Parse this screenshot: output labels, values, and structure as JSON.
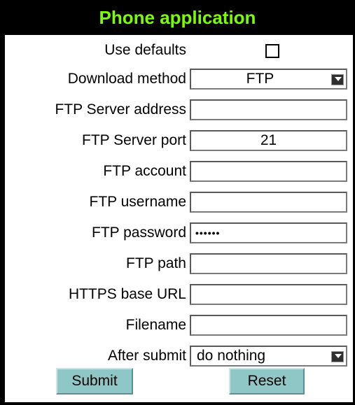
{
  "header": {
    "title": "Phone application"
  },
  "form": {
    "use_defaults_label": "Use defaults",
    "use_defaults_checked": false,
    "download_method_label": "Download method",
    "download_method_value": "FTP",
    "ftp_server_address_label": "FTP Server address",
    "ftp_server_address_value": "",
    "ftp_server_port_label": "FTP Server port",
    "ftp_server_port_value": "21",
    "ftp_account_label": "FTP account",
    "ftp_account_value": "",
    "ftp_username_label": "FTP username",
    "ftp_username_value": "",
    "ftp_password_label": "FTP password",
    "ftp_password_value": "••••••",
    "ftp_path_label": "FTP path",
    "ftp_path_value": "",
    "https_base_url_label": "HTTPS base URL",
    "https_base_url_value": "",
    "filename_label": "Filename",
    "filename_value": "",
    "after_submit_label": "After submit",
    "after_submit_value": "do nothing"
  },
  "buttons": {
    "submit": "Submit",
    "reset": "Reset"
  },
  "colors": {
    "title": "#7cfc00",
    "frame": "#000000",
    "button": "#8fc7c7"
  }
}
